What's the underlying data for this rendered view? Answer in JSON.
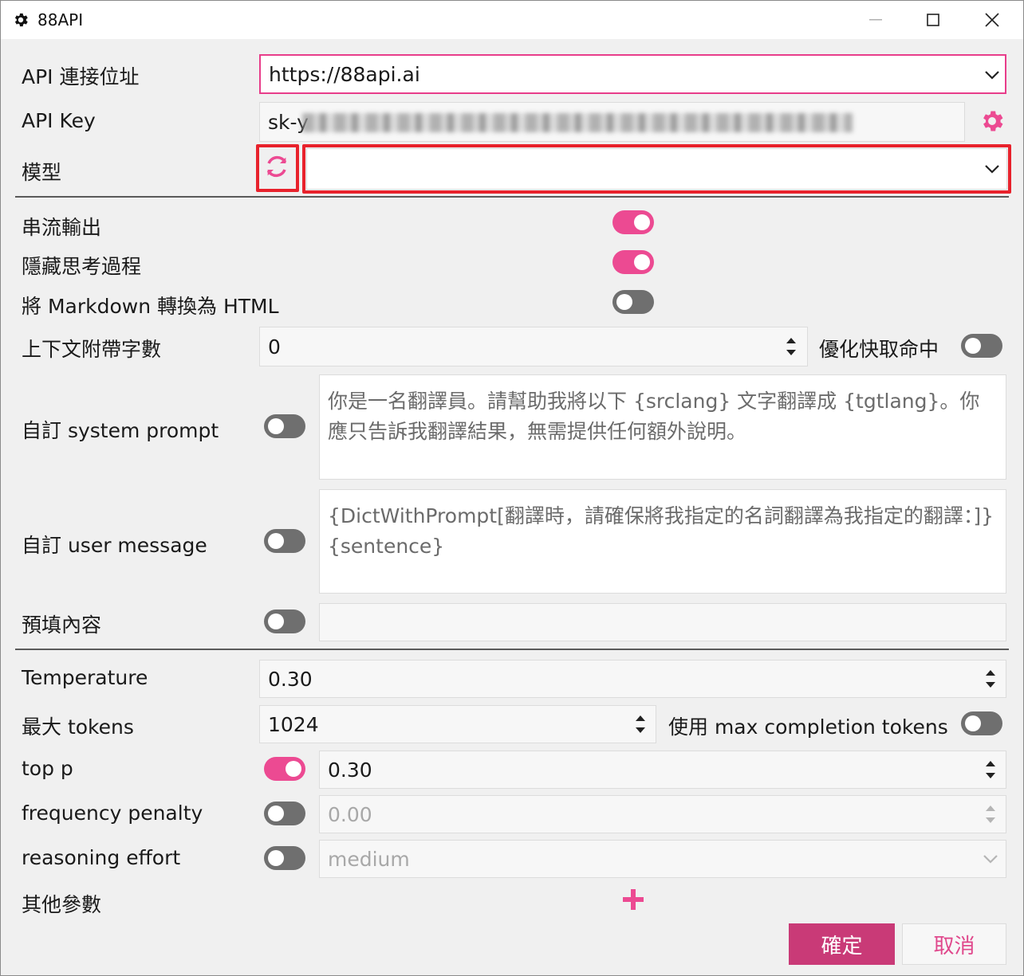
{
  "window": {
    "title": "88API",
    "icon": "gear-icon",
    "controls": [
      "minimize-icon",
      "maximize-icon",
      "close-icon"
    ]
  },
  "api": {
    "url_label": "API 連接位址",
    "url_value": "https://88api.ai",
    "key_label": "API Key",
    "key_value_prefix": "sk-y",
    "key_settings_icon": "gear-icon",
    "model_label": "模型",
    "model_value": "",
    "refresh_icon": "refresh-icon"
  },
  "options": {
    "streaming": {
      "label": "串流輸出",
      "on": true
    },
    "hide_thinking": {
      "label": "隱藏思考過程",
      "on": true
    },
    "markdown_html": {
      "label": "將 Markdown 轉換為 HTML",
      "on": false
    },
    "context_chars": {
      "label": "上下文附帶字數",
      "value": "0"
    },
    "cache_opt": {
      "label": "優化快取命中",
      "on": false
    },
    "system_prompt": {
      "label": "自訂 system prompt",
      "on": false,
      "text": "你是一名翻譯員。請幫助我將以下 {srclang} 文字翻譯成 {tgtlang}。你應只告訴我翻譯結果，無需提供任何額外說明。"
    },
    "user_message": {
      "label": "自訂 user message",
      "on": false,
      "text": "{DictWithPrompt[翻譯時，請確保將我指定的名詞翻譯為我指定的翻譯：]}\n{sentence}"
    },
    "prefill": {
      "label": "預填內容",
      "on": false,
      "value": ""
    }
  },
  "params": {
    "temperature": {
      "label": "Temperature",
      "value": "0.30"
    },
    "max_tokens": {
      "label": "最大 tokens",
      "value": "1024"
    },
    "max_completion": {
      "label": "使用 max completion tokens",
      "on": false
    },
    "top_p": {
      "label": "top p",
      "on": true,
      "value": "0.30"
    },
    "frequency_penalty": {
      "label": "frequency penalty",
      "on": false,
      "value": "0.00"
    },
    "reasoning_effort": {
      "label": "reasoning effort",
      "on": false,
      "value": "medium"
    },
    "other": {
      "label": "其他參數",
      "add_icon": "plus-icon"
    }
  },
  "buttons": {
    "ok": "確定",
    "cancel": "取消"
  },
  "colors": {
    "accent": "#ec4a92",
    "ok_button": "#c93a77",
    "highlight": "#e8222c"
  }
}
